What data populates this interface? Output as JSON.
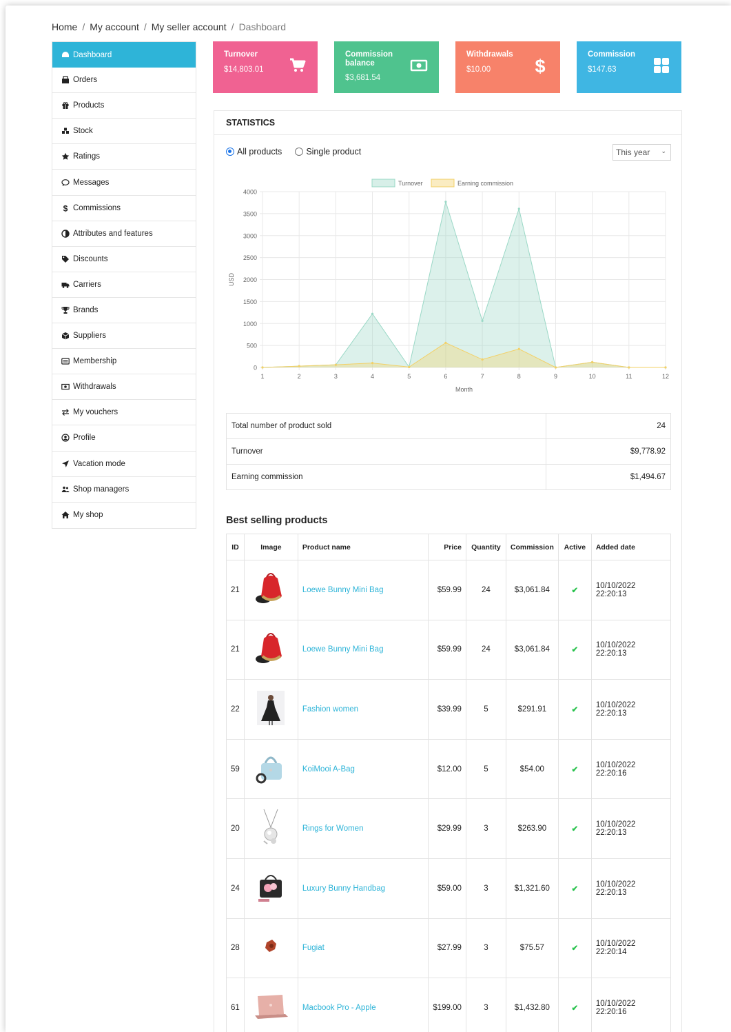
{
  "breadcrumb": {
    "items": [
      "Home",
      "My account",
      "My seller account"
    ],
    "current": "Dashboard"
  },
  "sidebar": {
    "items": [
      {
        "label": "Dashboard",
        "icon": "dashboard-icon"
      },
      {
        "label": "Orders",
        "icon": "orders-icon"
      },
      {
        "label": "Products",
        "icon": "gift-icon"
      },
      {
        "label": "Stock",
        "icon": "stock-icon"
      },
      {
        "label": "Ratings",
        "icon": "star-icon"
      },
      {
        "label": "Messages",
        "icon": "comment-icon"
      },
      {
        "label": "Commissions",
        "icon": "dollar-icon"
      },
      {
        "label": "Attributes and features",
        "icon": "half-circle-icon"
      },
      {
        "label": "Discounts",
        "icon": "tag-icon"
      },
      {
        "label": "Carriers",
        "icon": "truck-icon"
      },
      {
        "label": "Brands",
        "icon": "trophy-icon"
      },
      {
        "label": "Suppliers",
        "icon": "box-icon"
      },
      {
        "label": "Membership",
        "icon": "card-icon"
      },
      {
        "label": "Withdrawals",
        "icon": "money-icon"
      },
      {
        "label": "My vouchers",
        "icon": "exchange-icon"
      },
      {
        "label": "Profile",
        "icon": "user-circle-icon"
      },
      {
        "label": "Vacation mode",
        "icon": "plane-icon"
      },
      {
        "label": "Shop managers",
        "icon": "users-icon"
      },
      {
        "label": "My shop",
        "icon": "home-icon"
      }
    ]
  },
  "cards": [
    {
      "title": "Turnover",
      "value": "$14,803.01",
      "icon": "cart-icon",
      "color": "#f06292"
    },
    {
      "title": "Commission balance",
      "value": "$3,681.54",
      "icon": "money-icon",
      "color": "#4fc38e"
    },
    {
      "title": "Withdrawals",
      "value": "$10.00",
      "icon": "dollar-icon",
      "color": "#f7826a"
    },
    {
      "title": "Commission",
      "value": "$147.63",
      "icon": "grid-icon",
      "color": "#3fb6e3"
    }
  ],
  "statistics": {
    "title": "STATISTICS",
    "radio_all": "All products",
    "radio_single": "Single product",
    "period": "This year"
  },
  "chart_data": {
    "type": "area",
    "x": [
      1,
      2,
      3,
      4,
      5,
      6,
      7,
      8,
      9,
      10,
      11,
      12
    ],
    "series": [
      {
        "name": "Turnover",
        "color": "#9ad8c6",
        "values": [
          0,
          30,
          60,
          1220,
          10,
          3770,
          1060,
          3610,
          0,
          120,
          0,
          0
        ]
      },
      {
        "name": "Earning commission",
        "color": "#f3d066",
        "values": [
          0,
          30,
          60,
          100,
          10,
          560,
          180,
          420,
          0,
          120,
          0,
          0
        ]
      }
    ],
    "xlabel": "Month",
    "ylabel": "USD",
    "ylim": [
      0,
      4000
    ],
    "yticks": [
      0,
      500,
      1000,
      1500,
      2000,
      2500,
      3000,
      3500,
      4000
    ],
    "grid": true,
    "legend": "top-center"
  },
  "summary": [
    {
      "label": "Total number of product sold",
      "value": "24"
    },
    {
      "label": "Turnover",
      "value": "$9,778.92"
    },
    {
      "label": "Earning commission",
      "value": "$1,494.67"
    }
  ],
  "best_selling": {
    "title": "Best selling products",
    "headers": [
      "ID",
      "Image",
      "Product name",
      "Price",
      "Quantity",
      "Commission",
      "Active",
      "Added date"
    ],
    "rows": [
      {
        "id": "21",
        "name": "Loewe Bunny Mini Bag",
        "price": "$59.99",
        "qty": "24",
        "commission": "$3,061.84",
        "date": "10/10/2022 22:20:13",
        "thumb": "red-bag"
      },
      {
        "id": "21",
        "name": "Loewe Bunny Mini Bag",
        "price": "$59.99",
        "qty": "24",
        "commission": "$3,061.84",
        "date": "10/10/2022 22:20:13",
        "thumb": "red-bag"
      },
      {
        "id": "22",
        "name": "Fashion women",
        "price": "$39.99",
        "qty": "5",
        "commission": "$291.91",
        "date": "10/10/2022 22:20:13",
        "thumb": "dress"
      },
      {
        "id": "59",
        "name": "KoiMooi A-Bag",
        "price": "$12.00",
        "qty": "5",
        "commission": "$54.00",
        "date": "10/10/2022 22:20:16",
        "thumb": "blue-bag"
      },
      {
        "id": "20",
        "name": "Rings for Women",
        "price": "$29.99",
        "qty": "3",
        "commission": "$263.90",
        "date": "10/10/2022 22:20:13",
        "thumb": "necklace"
      },
      {
        "id": "24",
        "name": "Luxury Bunny Handbag",
        "price": "$59.00",
        "qty": "3",
        "commission": "$1,321.60",
        "date": "10/10/2022 22:20:13",
        "thumb": "flower-bag"
      },
      {
        "id": "28",
        "name": "Fugiat",
        "price": "$27.99",
        "qty": "3",
        "commission": "$75.57",
        "date": "10/10/2022 22:20:14",
        "thumb": "brown-item"
      },
      {
        "id": "61",
        "name": "Macbook Pro - Apple",
        "price": "$199.00",
        "qty": "3",
        "commission": "$1,432.80",
        "date": "10/10/2022 22:20:16",
        "thumb": "laptop"
      }
    ]
  }
}
